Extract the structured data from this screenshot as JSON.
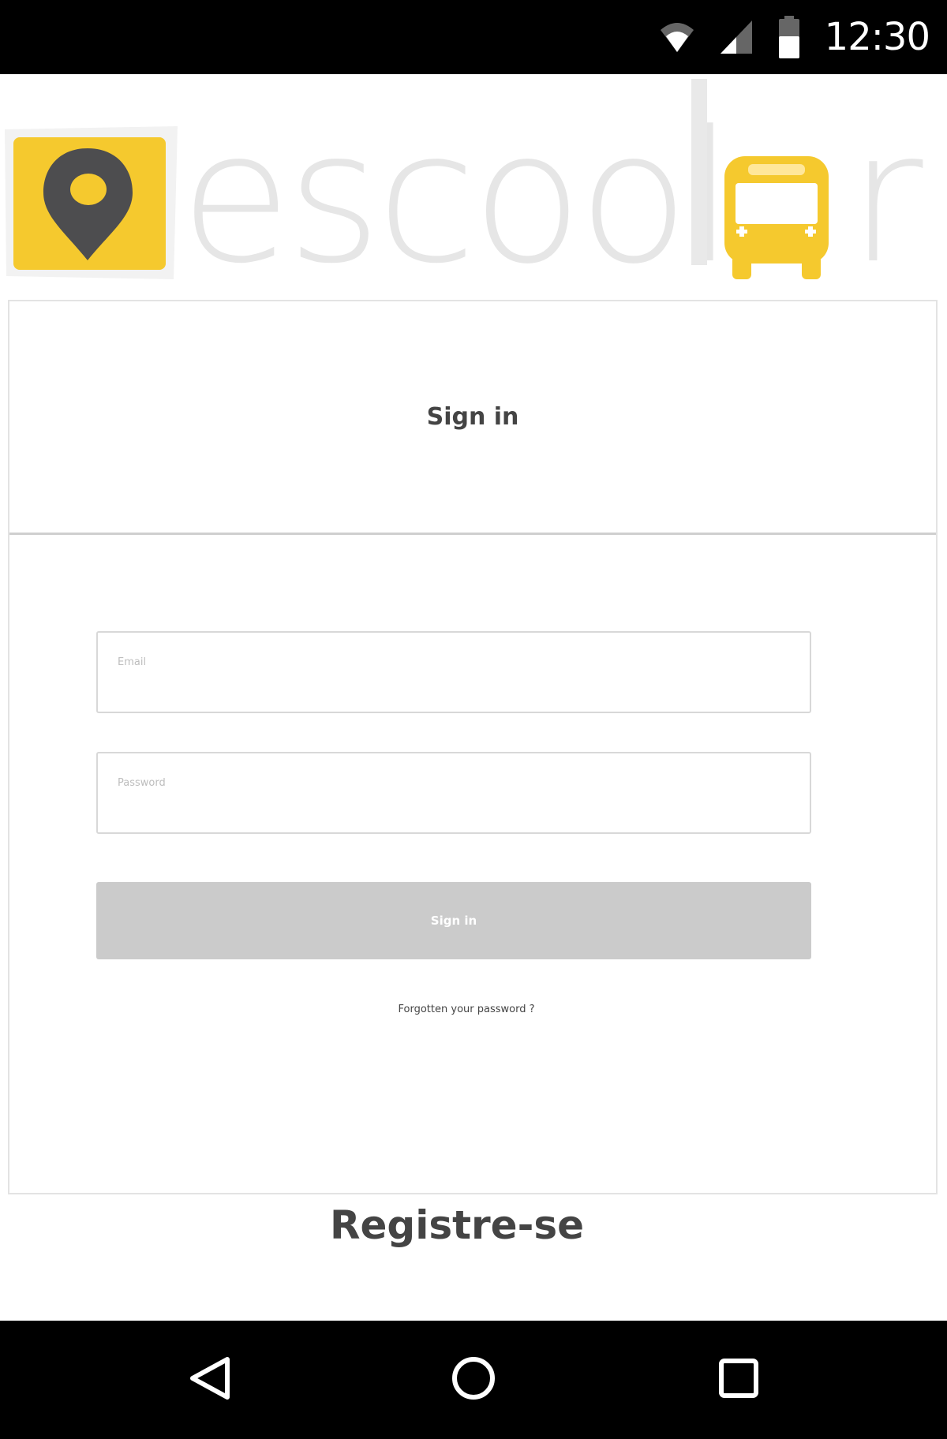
{
  "status_bar": {
    "time": "12:30",
    "icons": [
      "wifi-icon",
      "cell-signal-icon",
      "battery-icon"
    ]
  },
  "logo": {
    "text": "escoolar",
    "colors": {
      "yellow": "#F5C92E",
      "pin": "#4D4D4F",
      "text": "#E6E6E6"
    }
  },
  "sign_in_card": {
    "title": "Sign in",
    "email_field": {
      "label": "Email",
      "value": ""
    },
    "password_field": {
      "label": "Password",
      "value": ""
    },
    "submit_label": "Sign in",
    "forgot_link": "Forgotten your password ?"
  },
  "register": {
    "label": "Registre-se"
  },
  "nav_bar": {
    "buttons": [
      "back-icon",
      "home-icon",
      "recents-icon"
    ]
  }
}
